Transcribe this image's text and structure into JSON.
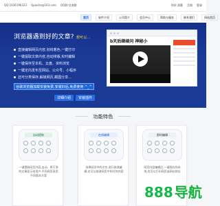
{
  "topbar": {
    "left": [
      "QQ:1636196323",
      "Qpasite@163.com",
      "QQ群:交流群"
    ],
    "right": [
      "你好,游客",
      "注册",
      "登录"
    ]
  },
  "nav": [
    {
      "label": "首页",
      "active": true
    },
    {
      "label": "软件介绍",
      "active": false
    },
    {
      "label": "公司简介",
      "active": false
    },
    {
      "label": "会员中心",
      "active": false
    },
    {
      "label": "帮助与服务",
      "active": false
    },
    {
      "label": "联系我们",
      "active": false
    },
    {
      "label": "网站首页",
      "active": false
    }
  ],
  "hero": {
    "title_main": "浏览器遇到好的文章?",
    "title_highlight": "想可以...",
    "features": [
      "直接编辑网页内容,划线着色,一键打印",
      "一键提取文章内容,自动排版,实时编辑",
      "一键保存至本机、云盘、资料浏览",
      "一键定向发布至网站、公众号、小程序",
      "还可分类保存,解锁网页,截图分享..."
    ],
    "cta": "谷歌浏览器加载安装免费,安装好后,免费使用 ^_^",
    "detail_button": "详细介绍",
    "install_button": "安装插件"
  },
  "screenshot": {
    "title": "b天后继续问 神秘小"
  },
  "section": {
    "title": "功能特色"
  },
  "cards": [
    {
      "title": "自动提取",
      "text": "一键提取网页内容,自动、将干净的文章显示给用户,不同网页采用不同版本方案"
    },
    {
      "title": "在线编辑",
      "text": "选择网页中的文字,进行修改编辑,也可以修改网页中的任何内容"
    },
    {
      "title": "即时编辑",
      "text": "网页内容编辑后,一键保存到本地,也可以打印网页或网站地址"
    }
  ],
  "watermark": {
    "number": "888",
    "text": "导航"
  }
}
